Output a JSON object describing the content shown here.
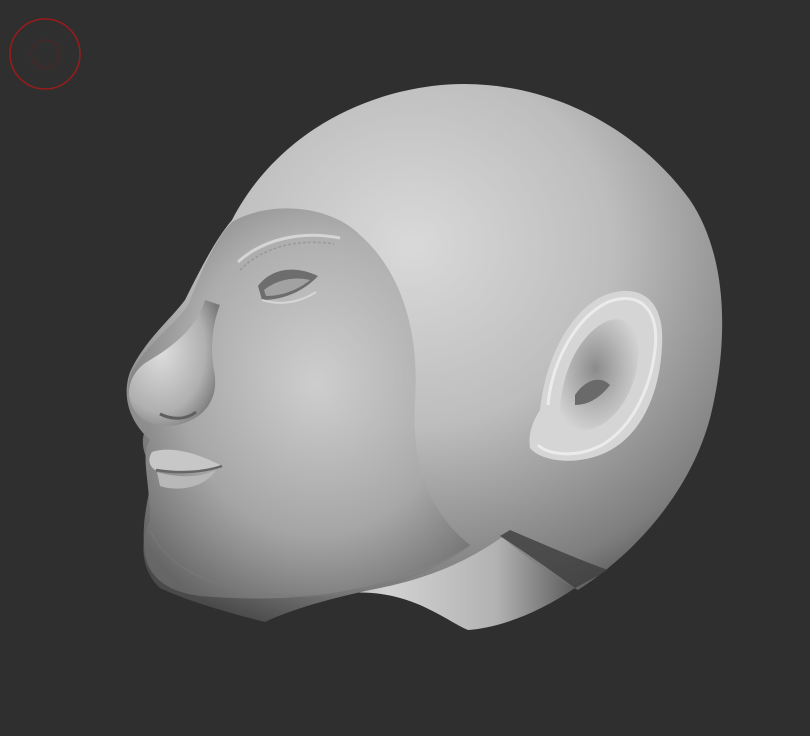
{
  "app": {
    "kind": "3d-sculpting-viewport"
  },
  "viewport": {
    "background_color": "#2f2f2f"
  },
  "brush_cursor": {
    "icon": "brush-circle-icon",
    "color": "#9b1b1b"
  },
  "model": {
    "subject": "head-sculpt",
    "material_color": "#b4b4b4",
    "shadow_color": "#3a3a3a",
    "highlight_color": "#e2e2e2"
  }
}
